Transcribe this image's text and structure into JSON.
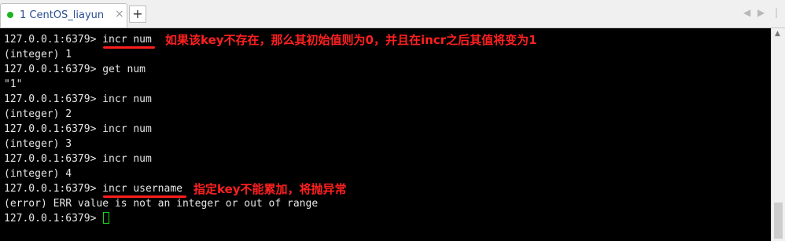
{
  "tabs": [
    {
      "label": "1 CentOS_liayun",
      "close": "×",
      "status_color": "#1fb31f"
    }
  ],
  "tabbar": {
    "add_label": "+",
    "nav_left": "◀",
    "nav_right": "▶",
    "nav_more": "|"
  },
  "terminal": {
    "lines": [
      "127.0.0.1:6379> incr num",
      "(integer) 1",
      "127.0.0.1:6379> get num",
      "\"1\"",
      "127.0.0.1:6379> incr num",
      "(integer) 2",
      "127.0.0.1:6379> incr num",
      "(integer) 3",
      "127.0.0.1:6379> incr num",
      "(integer) 4",
      "127.0.0.1:6379> incr username",
      "(error) ERR value is not an integer or out of range",
      "127.0.0.1:6379> "
    ]
  },
  "annotations": {
    "note1": "如果该key不存在，那么其初始值则为0，并且在incr之后其值将变为1",
    "note2": "指定key不能累加，将抛异常",
    "color": "#ff2020"
  }
}
